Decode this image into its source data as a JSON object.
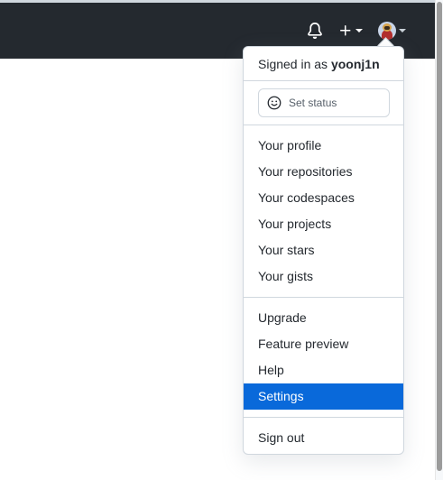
{
  "header": {
    "notifications_icon": "bell-icon",
    "create_icon": "plus-icon",
    "caret_icon": "caret-down-icon",
    "avatar_icon": "user-avatar"
  },
  "menu": {
    "signed_in_prefix": "Signed in as",
    "username": "yoonj1n",
    "status_label": "Set status",
    "status_icon": "smiley-icon",
    "section1": [
      "Your profile",
      "Your repositories",
      "Your codespaces",
      "Your projects",
      "Your stars",
      "Your gists"
    ],
    "section2": [
      "Upgrade",
      "Feature preview",
      "Help",
      "Settings"
    ],
    "active_item": "Settings",
    "sign_out": "Sign out"
  },
  "colors": {
    "header_bg": "#24292f",
    "active_bg": "#0969da",
    "border": "#d0d7de"
  }
}
